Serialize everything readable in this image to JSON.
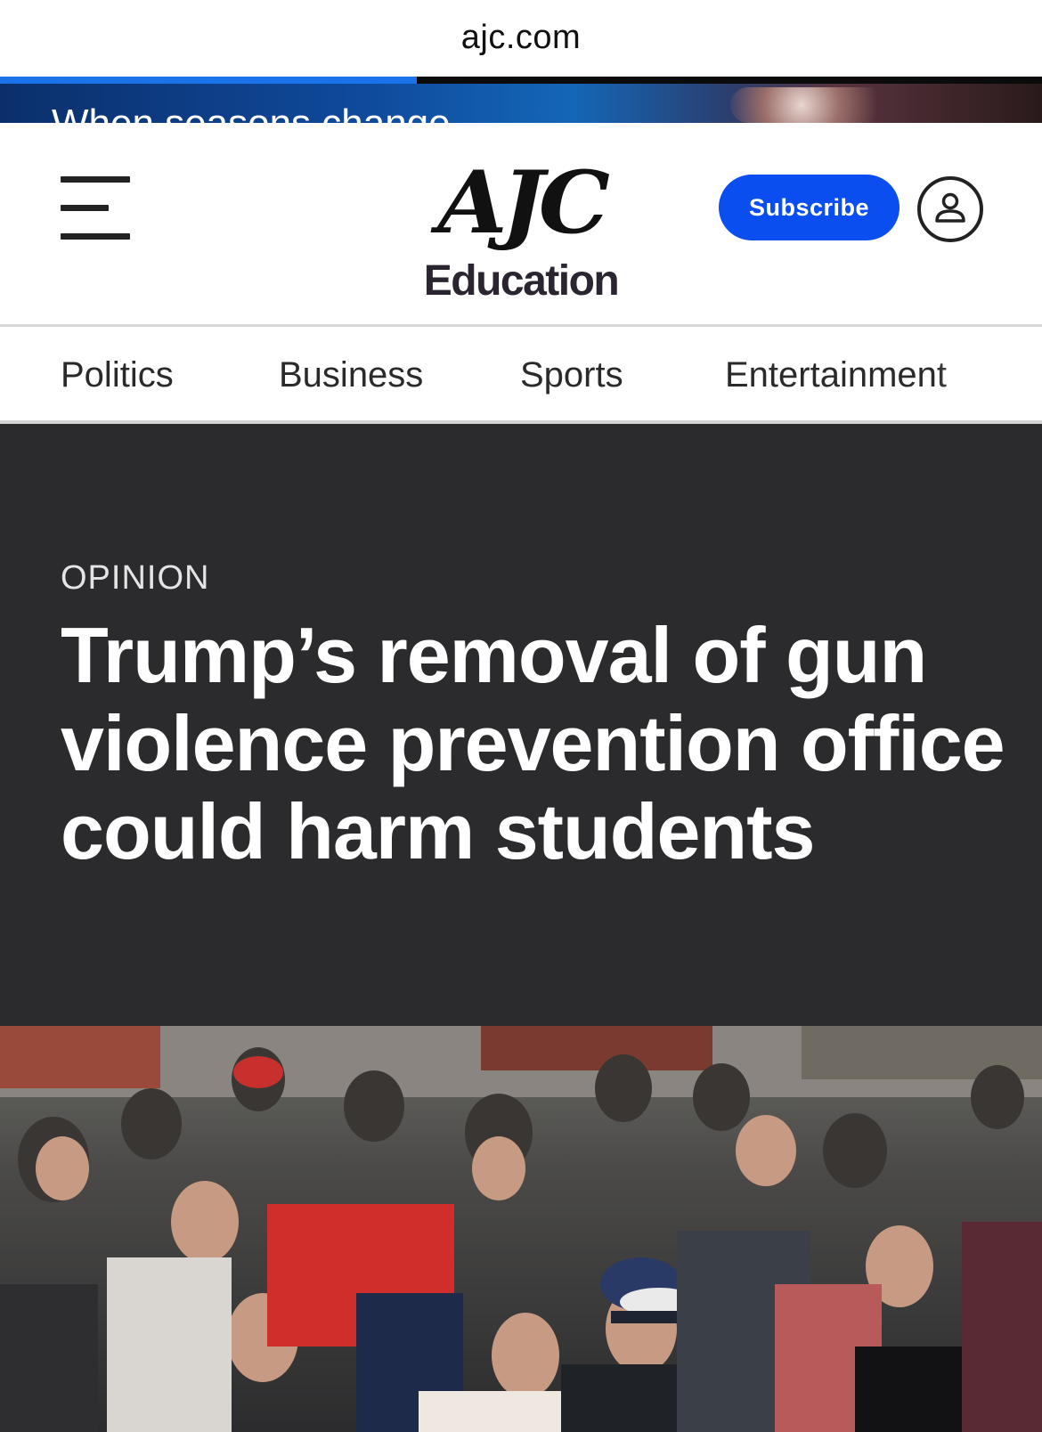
{
  "browser": {
    "url": "ajc.com",
    "load_progress": 0.4
  },
  "ad": {
    "text": "When seasons change"
  },
  "header": {
    "logo_text": "AJC",
    "section": "Education",
    "subscribe_label": "Subscribe",
    "menu_icon": "hamburger-menu-icon",
    "account_icon": "user-account-icon",
    "accent_color": "#0a4ef0"
  },
  "nav": {
    "items": [
      {
        "label": "Politics"
      },
      {
        "label": "Business"
      },
      {
        "label": "Sports"
      },
      {
        "label": "Entertainment"
      }
    ]
  },
  "article": {
    "kicker": "OPINION",
    "headline": "Trump’s removal of gun violence prevention office could harm students"
  }
}
